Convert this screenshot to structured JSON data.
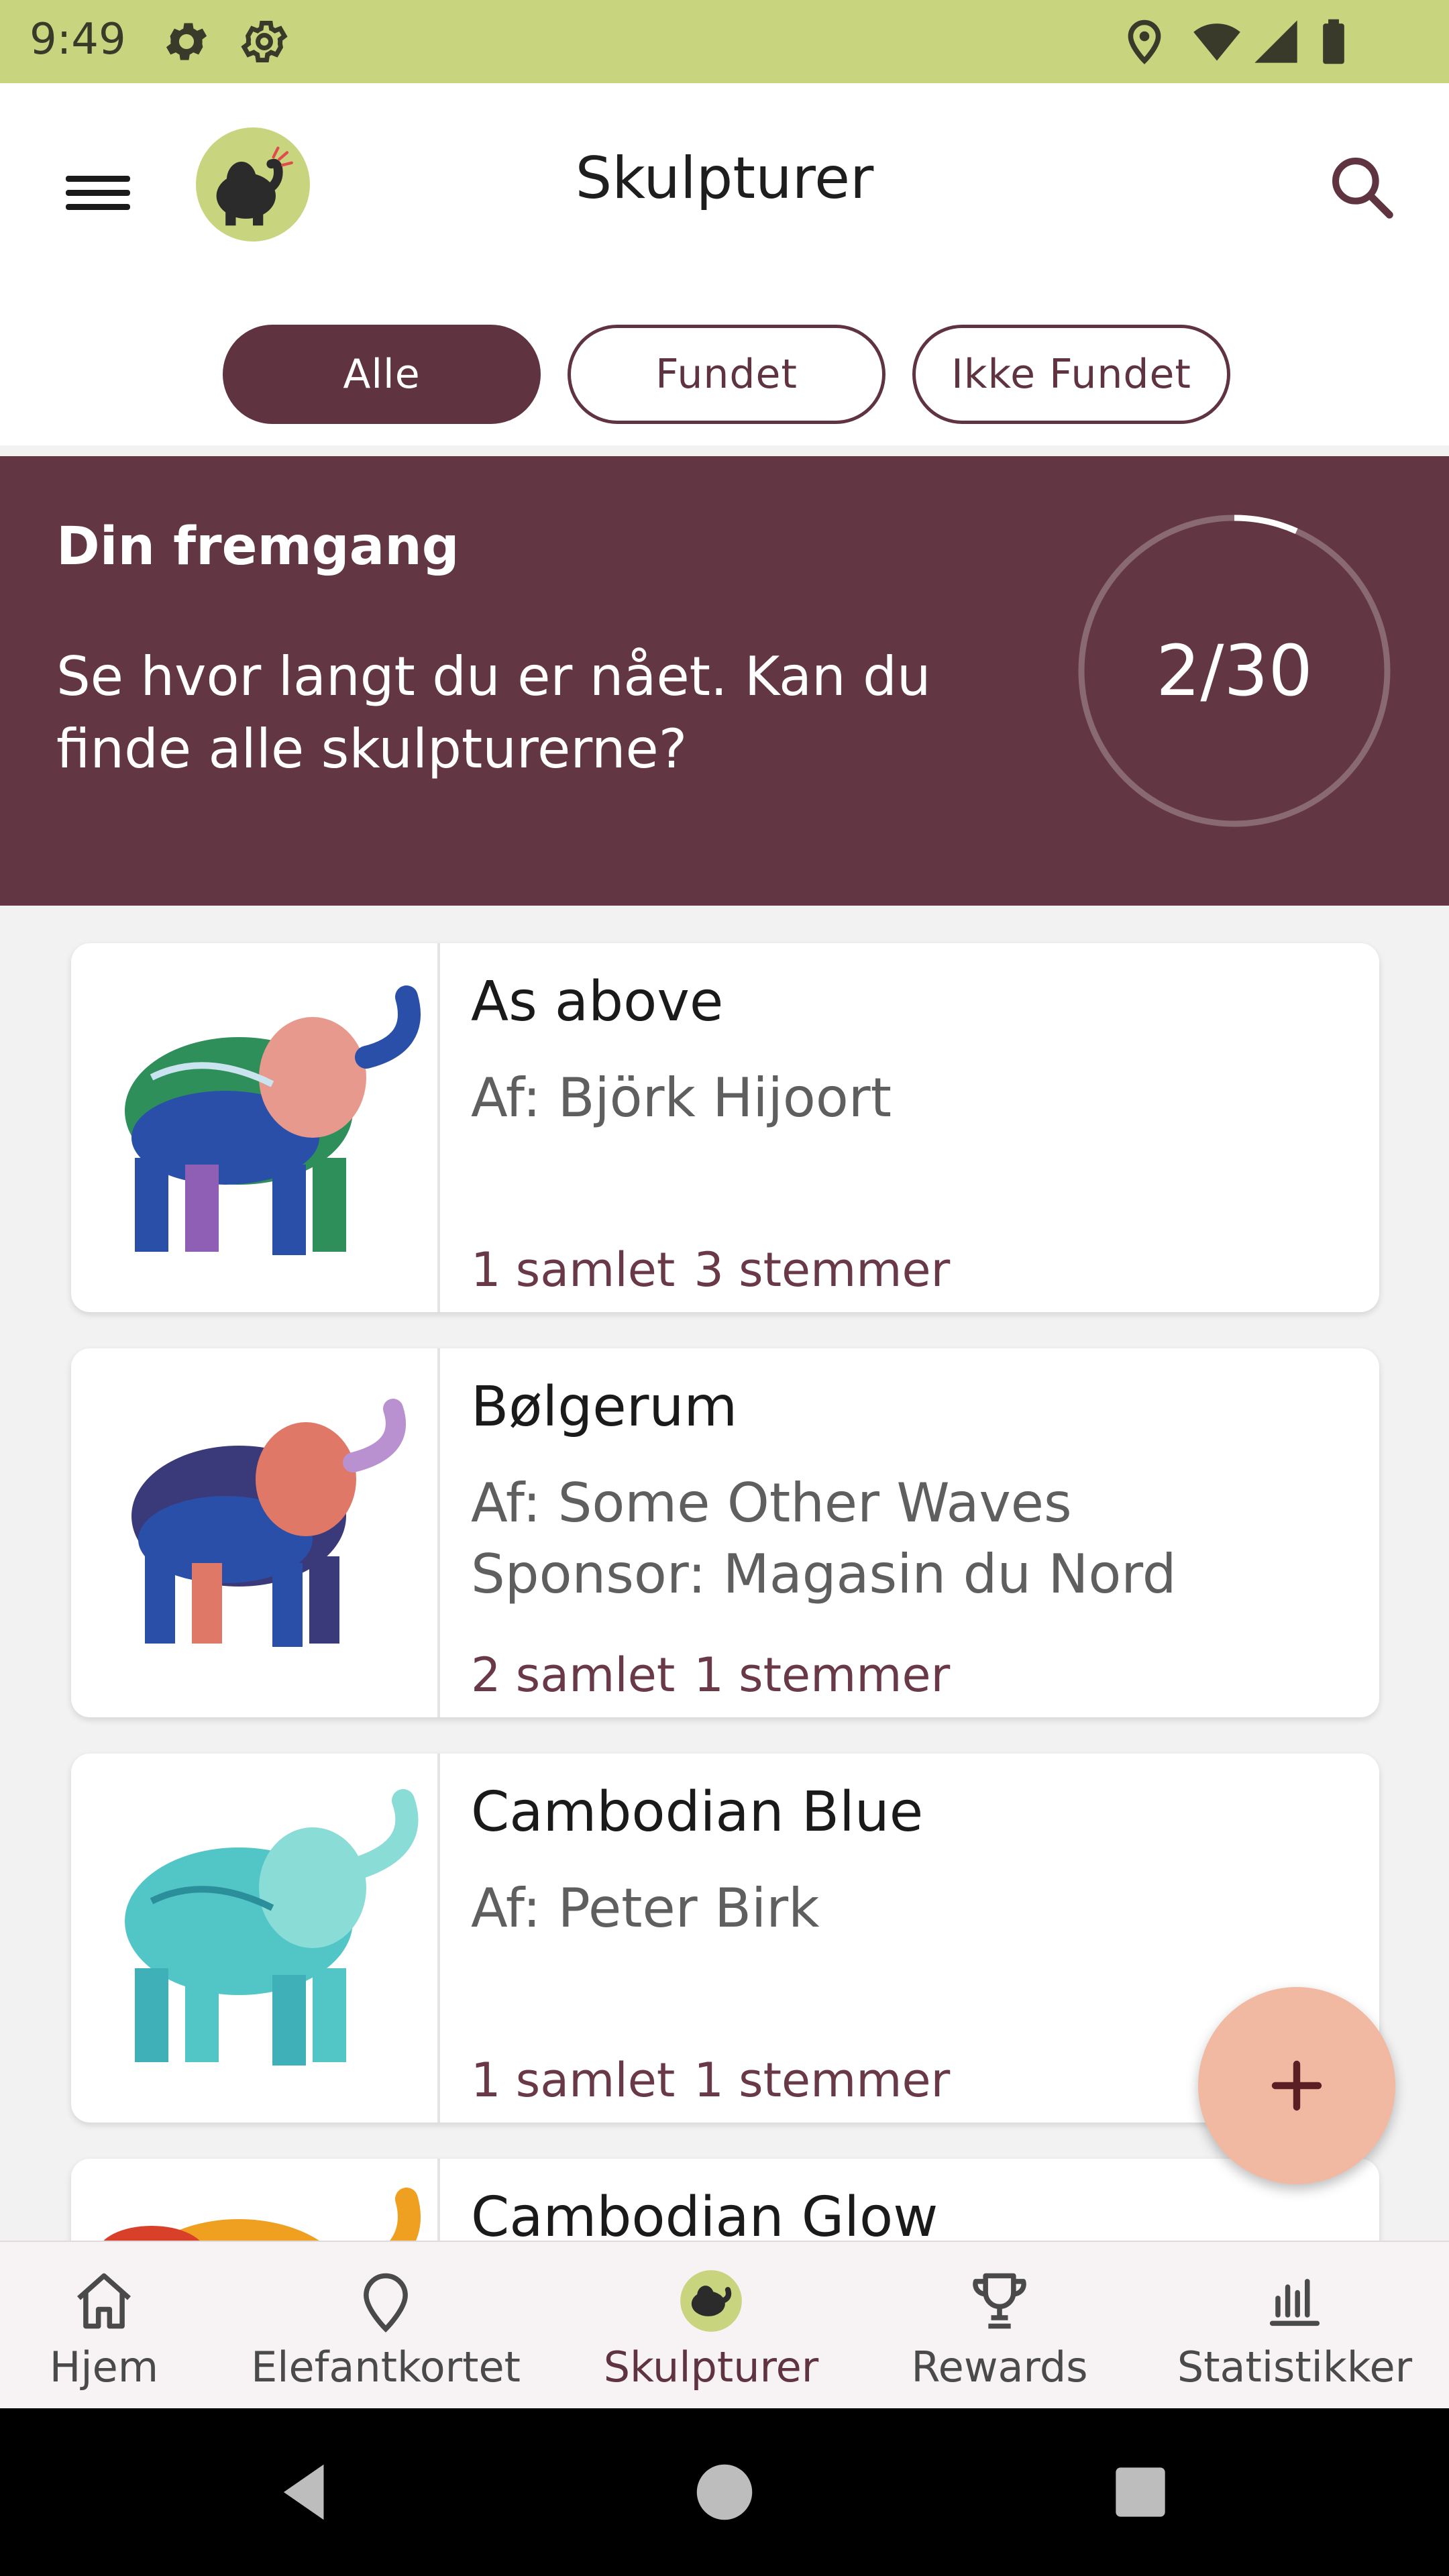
{
  "status_bar": {
    "time": "9:49",
    "left_icons": [
      "gear-icon",
      "settings-cog-icon"
    ],
    "right_icons": [
      "location-pin-icon",
      "wifi-icon",
      "cell-signal-icon",
      "battery-icon"
    ],
    "color": "#c8d47e"
  },
  "app_bar": {
    "title": "Skulpturer",
    "menu_icon": "hamburger-menu-icon",
    "logo_icon": "elephant-logo-icon",
    "search_icon": "search-icon"
  },
  "filters": [
    {
      "label": "Alle",
      "active": true
    },
    {
      "label": "Fundet",
      "active": false
    },
    {
      "label": "Ikke Fundet",
      "active": false
    }
  ],
  "progress": {
    "title": "Din fremgang",
    "text": "Se hvor langt du er nået. Kan du finde alle skulpturerne?",
    "found": 2,
    "total": 30,
    "label": "2/30",
    "color": "#623642"
  },
  "sculptures": [
    {
      "name": "As above",
      "artist": "Af: Björk Hijoort",
      "sponsor": "",
      "collected": "1 samlet",
      "votes": "3 stemmer"
    },
    {
      "name": "Bølgerum",
      "artist": "Af: Some Other Waves",
      "sponsor": "Sponsor: Magasin du Nord",
      "collected": "2 samlet",
      "votes": "1 stemmer"
    },
    {
      "name": "Cambodian Blue",
      "artist": "Af: Peter Birk",
      "sponsor": "",
      "collected": "1 samlet",
      "votes": "1 stemmer"
    },
    {
      "name": "Cambodian Glow",
      "artist": "",
      "sponsor": "",
      "collected": "",
      "votes": ""
    }
  ],
  "fab": {
    "icon": "plus-icon",
    "color": "#f2b9a2"
  },
  "bottom_nav": [
    {
      "label": "Hjem",
      "icon": "home-icon",
      "active": false
    },
    {
      "label": "Elefantkortet",
      "icon": "map-pin-icon",
      "active": false
    },
    {
      "label": "Skulpturer",
      "icon": "elephant-icon",
      "active": true
    },
    {
      "label": "Rewards",
      "icon": "trophy-icon",
      "active": false
    },
    {
      "label": "Statistikker",
      "icon": "bar-chart-icon",
      "active": false
    }
  ],
  "system_nav": {
    "icons": [
      "back-icon",
      "home-circle-icon",
      "recents-icon"
    ]
  }
}
